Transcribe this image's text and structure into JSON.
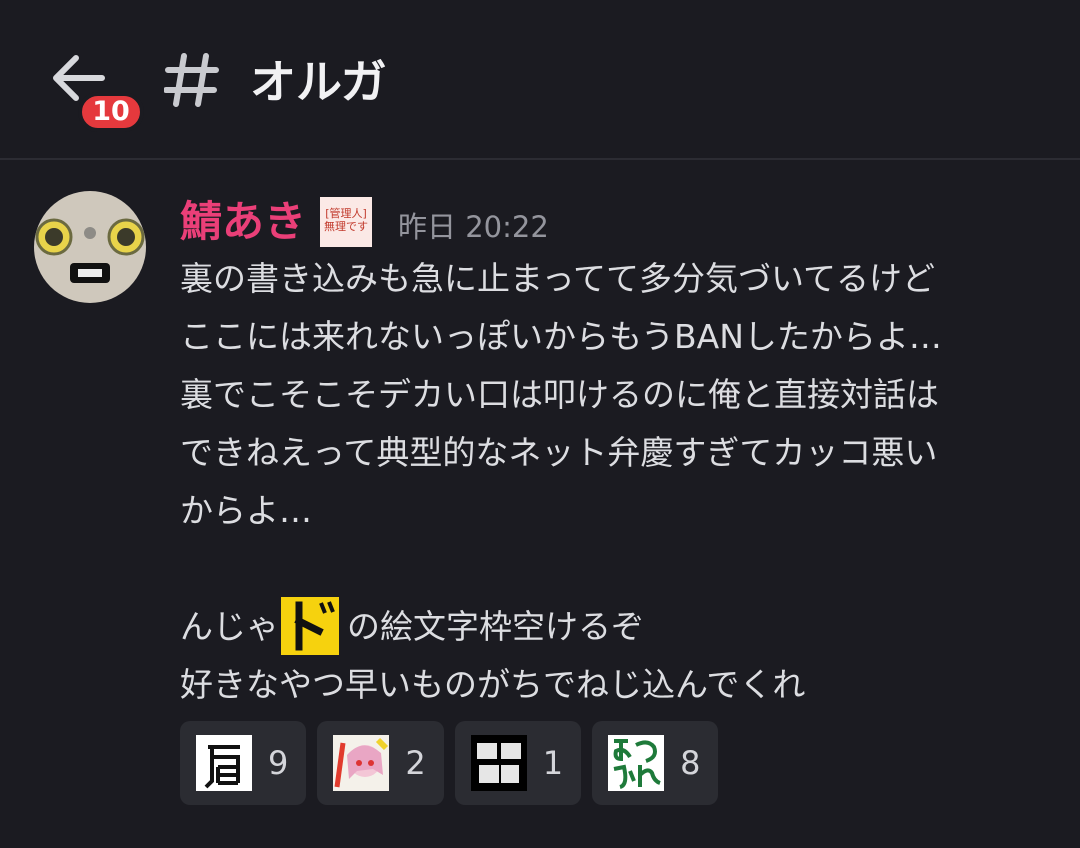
{
  "header": {
    "back_icon": "arrow-left-icon",
    "unread_badge": "10",
    "channel_icon": "hash-icon",
    "channel_name": "オルガ"
  },
  "message": {
    "author": {
      "name": "鯖あき",
      "name_color": "#ea3f78",
      "role_icon_text_line1": "[管理人]",
      "role_icon_text_line2": "無理です"
    },
    "timestamp": "昨日 20:22",
    "lines": [
      "裏の書き込みも急に止まってて多分気づいてるけど",
      "ここには来れないっぽいからもうBANしたからよ…",
      "裏でこそこそデカい口は叩けるのに俺と直接対話は",
      "できねえって典型的なネット弁慶すぎてカッコ悪い",
      "からよ…"
    ],
    "line_with_emoji": {
      "before": "んじゃ",
      "emoji_name": "do-katakana-emoji",
      "after": "の絵文字枠空けるぞ"
    },
    "last_line": "好きなやつ早いものがちでねじ込んでくれ"
  },
  "reactions": [
    {
      "emoji": "kata-kanji-emoji",
      "count": "9"
    },
    {
      "emoji": "yatta-anime-girl-emoji",
      "count": "2"
    },
    {
      "emoji": "shikata-nashi-emoji",
      "count": "1"
    },
    {
      "emoji": "otsukare-emoji",
      "count": "8"
    }
  ],
  "colors": {
    "background": "#1b1b21",
    "badge": "#e5393d",
    "reaction_bg": "#2b2c32",
    "timestamp": "#94959d"
  }
}
